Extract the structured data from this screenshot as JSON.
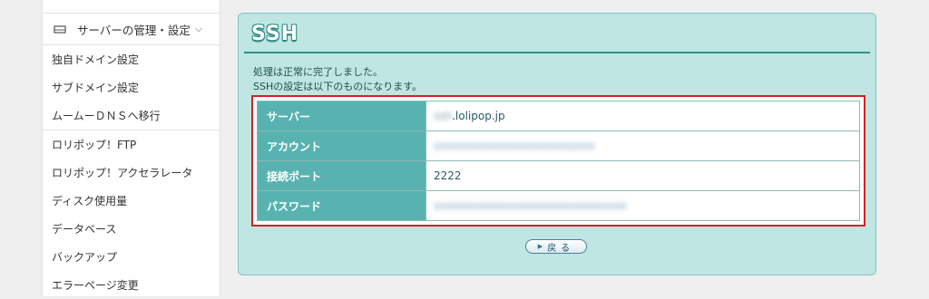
{
  "sidebar": {
    "section_title": "サーバーの管理・設定",
    "group1": [
      {
        "label": "独自ドメイン設定"
      },
      {
        "label": "サブドメイン設定"
      },
      {
        "label": "ムームーＤＮＳへ移行"
      }
    ],
    "group2": [
      {
        "label": "ロリポップ！FTP"
      },
      {
        "label": "ロリポップ！アクセラレータ"
      },
      {
        "label": "ディスク使用量"
      },
      {
        "label": "データベース"
      },
      {
        "label": "バックアップ"
      },
      {
        "label": "エラーページ変更"
      }
    ]
  },
  "main": {
    "title": "SSH",
    "message_line1": "処理は正常に完了しました。",
    "message_line2": "SSHの設定は以下のものになります。",
    "rows": [
      {
        "label": "サーバー",
        "value_hidden": "ssh",
        "value_visible": ".lolipop.jp"
      },
      {
        "label": "アカウント",
        "value_hidden": "xxxxxxxxxxxxxxxxxxxxxxxxx"
      },
      {
        "label": "接続ポート",
        "value": "2222"
      },
      {
        "label": "パスワード",
        "value_hidden": "xxxxxxxxxxxxxxxxxxxxxxxxxxxxxx"
      }
    ],
    "back_button": "戻る"
  },
  "colors": {
    "panel_bg": "#bfe6e3",
    "label_cell": "#58b3b0",
    "highlight_border": "#d81f26"
  }
}
